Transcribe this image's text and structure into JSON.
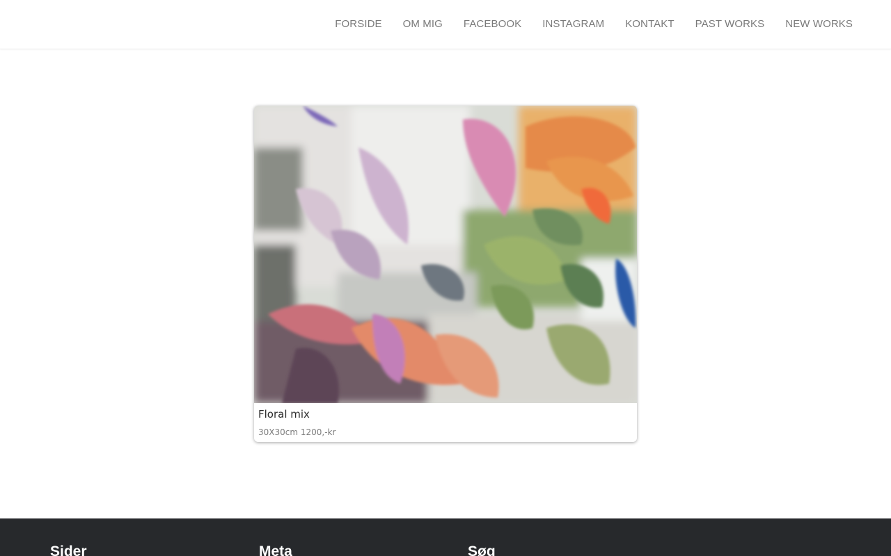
{
  "nav": {
    "items": [
      {
        "label": "FORSIDE"
      },
      {
        "label": "OM MIG"
      },
      {
        "label": "FACEBOOK"
      },
      {
        "label": "INSTAGRAM"
      },
      {
        "label": "KONTAKT"
      },
      {
        "label": "PAST WORKS"
      },
      {
        "label": "NEW WORKS"
      }
    ]
  },
  "artwork": {
    "title": "Floral mix",
    "description": "30X30cm 1200,-kr"
  },
  "footer": {
    "headings": [
      {
        "label": "Sider"
      },
      {
        "label": "Meta"
      },
      {
        "label": "Søg"
      }
    ]
  },
  "colors": {
    "footer_bg": "#27292c",
    "nav_text": "#7a7a7a"
  }
}
